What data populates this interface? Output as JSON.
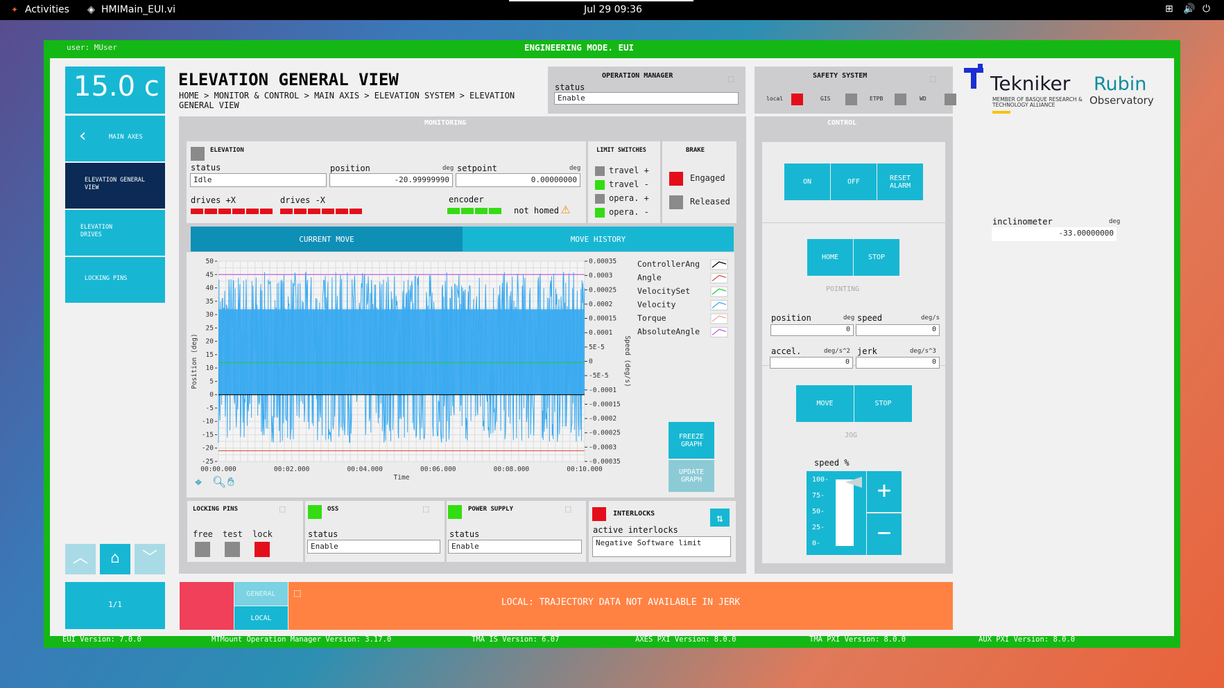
{
  "topbar": {
    "activities": "Activities",
    "app": "HMIMain_EUI.vi",
    "clock": "Jul 29  09:36"
  },
  "header": {
    "user": "user: MUser",
    "mode": "ENGINEERING MODE. EUI"
  },
  "temperature": "15.0 c",
  "page_title": "ELEVATION GENERAL VIEW",
  "breadcrumb": "HOME > MONITOR & CONTROL > MAIN AXIS > ELEVATION SYSTEM > ELEVATION GENERAL VIEW",
  "nav": {
    "back_label": "MAIN AXES",
    "items": [
      "ELEVATION GENERAL VIEW",
      "ELEVATION DRIVES",
      "LOCKING PINS"
    ],
    "page_indicator": "1/1"
  },
  "op_manager": {
    "title": "OPERATION MANAGER",
    "status_label": "status",
    "status_value": "Enable"
  },
  "safety": {
    "title": "SAFETY SYSTEM",
    "items": [
      {
        "label": "local",
        "color": "#e40e1a"
      },
      {
        "label": "GIS",
        "color": "#8a8a8a"
      },
      {
        "label": "ETPB",
        "color": "#8a8a8a"
      },
      {
        "label": "WD",
        "color": "#8a8a8a"
      }
    ]
  },
  "monitoring": {
    "title": "MONITORING",
    "elevation_label": "ELEVATION",
    "status_label": "status",
    "status_value": "Idle",
    "position_label": "position",
    "position_unit": "deg",
    "position_value": "-20.99999990",
    "setpoint_label": "setpoint",
    "setpoint_unit": "deg",
    "setpoint_value": "0.00000000",
    "drives_px_label": "drives +X",
    "drives_nx_label": "drives -X",
    "encoder_label": "encoder",
    "not_homed": "not homed",
    "limit_title": "LIMIT SWITCHES",
    "limits": [
      {
        "label": "travel +",
        "color": "#8a8a8a"
      },
      {
        "label": "travel -",
        "color": "#33dd11"
      },
      {
        "label": "opera. +",
        "color": "#8a8a8a"
      },
      {
        "label": "opera. -",
        "color": "#33dd11"
      }
    ],
    "brake_title": "BRAKE",
    "brakes": [
      {
        "label": "Engaged",
        "color": "#e40e1a"
      },
      {
        "label": "Released",
        "color": "#8a8a8a"
      }
    ],
    "tab_current": "CURRENT MOVE",
    "tab_history": "MOVE HISTORY",
    "freeze": "FREEZE GRAPH",
    "update": "UPDATE GRAPH"
  },
  "chart_data": {
    "type": "line",
    "xlabel": "Time",
    "ylabel": "Position (deg)",
    "y2label": "Speed (deg/s)",
    "ylim": [
      -25,
      50
    ],
    "y2lim": [
      -0.00035,
      0.00035
    ],
    "x_ticks": [
      "00:00.000",
      "00:02.000",
      "00:04.000",
      "00:06.000",
      "00:08.000",
      "00:10.000"
    ],
    "y_ticks": [
      "50",
      "45",
      "40",
      "35",
      "30",
      "25",
      "20",
      "15",
      "10",
      "5",
      "0",
      "-5",
      "-10",
      "-15",
      "-20",
      "-25"
    ],
    "y2_ticks": [
      "0.00035",
      "0.0003",
      "0.00025",
      "0.0002",
      "0.00015",
      "0.0001",
      "5E-5",
      "0",
      "-5E-5",
      "-0.0001",
      "-0.00015",
      "-0.0002",
      "-0.00025",
      "-0.0003",
      "-0.00035"
    ],
    "series": [
      {
        "name": "ControllerAng",
        "color": "#000000",
        "constant": 0
      },
      {
        "name": "Angle",
        "color": "#e05050",
        "constant": -21
      },
      {
        "name": "VelocitySet",
        "color": "#22cc44",
        "constant": 12
      },
      {
        "name": "Velocity",
        "color": "#3aaaf0",
        "noise_range": [
          -18,
          46
        ]
      },
      {
        "name": "Torque",
        "color": "#f2a3a3"
      },
      {
        "name": "AbsoluteAngle",
        "color": "#c060e0",
        "constant": 45
      }
    ]
  },
  "locking": {
    "title": "LOCKING PINS",
    "labels": [
      "free",
      "test",
      "lock"
    ],
    "colors": [
      "#8a8a8a",
      "#8a8a8a",
      "#e40e1a"
    ]
  },
  "oss": {
    "title": "OSS",
    "status_label": "status",
    "status_value": "Enable"
  },
  "power": {
    "title": "POWER SUPPLY",
    "status_label": "status",
    "status_value": "Enable"
  },
  "interlocks": {
    "title": "INTERLOCKS",
    "active_label": "active interlocks",
    "active_value": "Negative Software limit"
  },
  "control": {
    "title": "CONTROL",
    "on": "ON",
    "off": "OFF",
    "reset": "RESET ALARM",
    "home": "HOME",
    "stop": "STOP",
    "pointing": "POINTING",
    "position_label": "position",
    "position_unit": "deg",
    "position_value": "0",
    "speed_label": "speed",
    "speed_unit": "deg/s",
    "speed_value": "0",
    "accel_label": "accel.",
    "accel_unit": "deg/s^2",
    "accel_value": "0",
    "jerk_label": "jerk",
    "jerk_unit": "deg/s^3",
    "jerk_value": "0",
    "move": "MOVE",
    "jog_stop": "STOP",
    "jog": "JOG",
    "speed_pct_label": "speed %",
    "speed_ticks": [
      "100-",
      "75-",
      "50-",
      "25-",
      "0-"
    ],
    "speed_pct": 100,
    "plus": "+",
    "minus": "−"
  },
  "inclinometer": {
    "label": "inclinometer",
    "unit": "deg",
    "value": "-33.00000000"
  },
  "logos": {
    "tekniker": "Tekniker",
    "tekniker_sub": "MEMBER OF BASQUE RESEARCH & TECHNOLOGY ALLIANCE",
    "rubin": "Rubin",
    "rubin_sub": "Observatory"
  },
  "footer_bar": {
    "general": "GENERAL",
    "local": "LOCAL",
    "message": "LOCAL: TRAJECTORY DATA NOT AVAILABLE IN JERK"
  },
  "versions": [
    "EUI Version: 7.0.0",
    "MTMount Operation Manager Version: 3.17.0",
    "TMA IS Version: 6.07",
    "AXES PXI Version: 8.0.0",
    "TMA PXI Version: 8.0.0",
    "AUX PXI Version: 8.0.0"
  ]
}
